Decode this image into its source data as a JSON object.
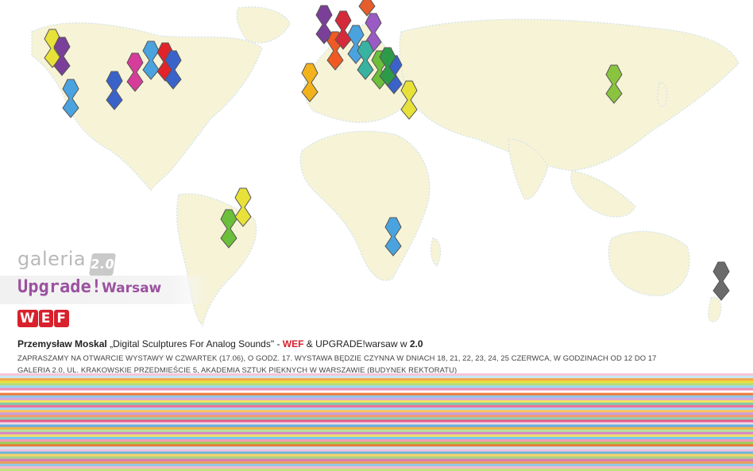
{
  "branding": {
    "galeria_text": "galeria",
    "galeria_badge": "2.0",
    "upgrade_main": "Upgrade!",
    "upgrade_city": "Warsaw",
    "wef_letters": [
      "W",
      "E",
      "F"
    ]
  },
  "headline": {
    "artist": "Przemysław Moskal",
    "title": "„Digital Sculptures For Analog Sounds\"",
    "sep": " - ",
    "wef": "WEF",
    "rest": " & UPGRADE!warsaw w ",
    "venue": "2.0"
  },
  "info_lines": [
    "ZAPRASZAMY NA OTWARCIE WYSTAWY W CZWARTEK (17.06), O GODZ. 17. WYSTAWA BĘDZIE CZYNNA W DNIACH 18, 21, 22, 23, 24, 25 CZERWCA, W GODZINACH OD 12 DO 17",
    "GALERIA 2.0, UL. KRAKOWSKIE PRZEDMIEŚCIE 5, AKADEMIA SZTUK PIĘKNYCH W WARSZAWIE (BUDYNEK REKTORATU)"
  ],
  "colors": {
    "accent_purple": "#9b52a0",
    "accent_red": "#d8212c",
    "land_yellow": "#f7f3d6"
  },
  "markers": [
    {
      "name": "seattle",
      "color": "#e8e13a"
    },
    {
      "name": "vancouver",
      "color": "#7a3f98"
    },
    {
      "name": "san-francisco",
      "color": "#4aa3df"
    },
    {
      "name": "denver",
      "color": "#3a63c9"
    },
    {
      "name": "chicago",
      "color": "#d63c9a"
    },
    {
      "name": "toronto",
      "color": "#4aa3df"
    },
    {
      "name": "montreal",
      "color": "#e2232a"
    },
    {
      "name": "new-york",
      "color": "#3a63c9"
    },
    {
      "name": "lisbon",
      "color": "#f2b21b"
    },
    {
      "name": "london",
      "color": "#7a3f98"
    },
    {
      "name": "paris",
      "color": "#f05a22"
    },
    {
      "name": "amsterdam",
      "color": "#d42a3a"
    },
    {
      "name": "berlin",
      "color": "#4aa3df"
    },
    {
      "name": "oslo",
      "color": "#e55d2b"
    },
    {
      "name": "stockholm",
      "color": "#9a5bc4"
    },
    {
      "name": "vienna",
      "color": "#38b2a1"
    },
    {
      "name": "prague",
      "color": "#6bbf3a"
    },
    {
      "name": "warsaw",
      "color": "#3a63c9"
    },
    {
      "name": "budapest",
      "color": "#2d9a4a"
    },
    {
      "name": "istanbul",
      "color": "#e8e13a"
    },
    {
      "name": "beijing",
      "color": "#8ac43f"
    },
    {
      "name": "sao-paulo",
      "color": "#6bbf3a"
    },
    {
      "name": "rio",
      "color": "#e8e13a"
    },
    {
      "name": "johannesburg",
      "color": "#4aa3df"
    },
    {
      "name": "sydney",
      "color": "#6b6b6b"
    }
  ]
}
